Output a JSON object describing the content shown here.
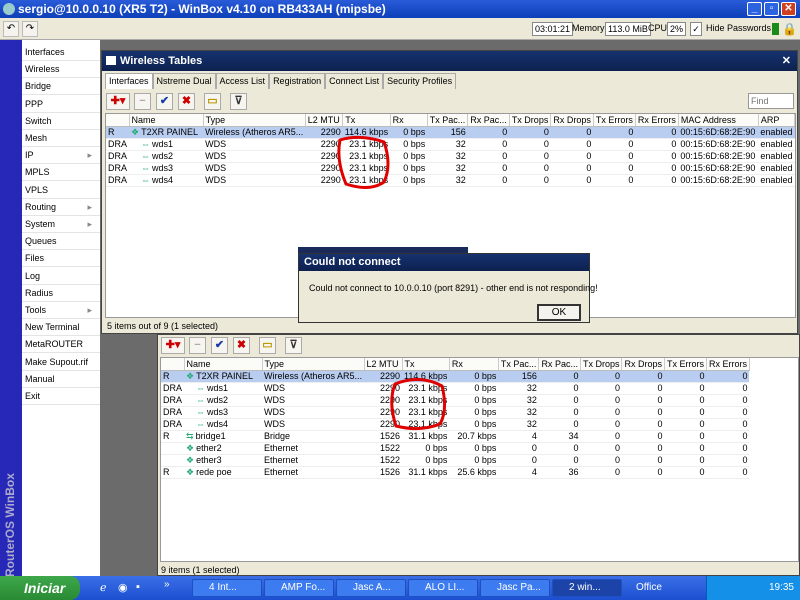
{
  "window": {
    "title": "sergio@10.0.0.10 (XR5 T2) - WinBox v4.10 on RB433AH (mipsbe)"
  },
  "toolbar": {
    "time": "03:01:21",
    "memory_label": "Memory:",
    "memory": "113.0 MiB",
    "cpu_label": "CPU:",
    "cpu": "2%",
    "hide_passwords": "Hide Passwords",
    "hide_passwords_checked": true
  },
  "sidebar": {
    "brand": "RouterOS WinBox",
    "items": [
      {
        "label": "Interfaces"
      },
      {
        "label": "Wireless"
      },
      {
        "label": "Bridge"
      },
      {
        "label": "PPP"
      },
      {
        "label": "Switch"
      },
      {
        "label": "Mesh"
      },
      {
        "label": "IP",
        "sub": true
      },
      {
        "label": "MPLS"
      },
      {
        "label": "VPLS"
      },
      {
        "label": "Routing",
        "sub": true
      },
      {
        "label": "System",
        "sub": true
      },
      {
        "label": "Queues"
      },
      {
        "label": "Files"
      },
      {
        "label": "Log"
      },
      {
        "label": "Radius"
      },
      {
        "label": "Tools",
        "sub": true
      },
      {
        "label": "New Terminal"
      },
      {
        "label": "MetaROUTER"
      },
      {
        "label": "Make Supout.rif"
      },
      {
        "label": "Manual"
      },
      {
        "label": "Exit"
      }
    ]
  },
  "wireless": {
    "title": "Wireless Tables",
    "tabs": [
      "Interfaces",
      "Nstreme Dual",
      "Access List",
      "Registration",
      "Connect List",
      "Security Profiles"
    ],
    "find_placeholder": "Find",
    "columns": [
      "",
      "Name",
      "Type",
      "L2 MTU",
      "Tx",
      "Rx",
      "Tx Pac...",
      "Rx Pac...",
      "Tx Drops",
      "Rx Drops",
      "Tx Errors",
      "Rx Errors",
      "MAC Address",
      "ARP"
    ],
    "rows": [
      [
        "R",
        "T2XR PAINEL",
        "Wireless (Atheros AR5...",
        "2290",
        "114.6 kbps",
        "0 bps",
        "156",
        "0",
        "0",
        "0",
        "0",
        "0",
        "00:15:6D:68:2E:90",
        "enabled"
      ],
      [
        "DRA",
        "wds1",
        "WDS",
        "2290",
        "23.1 kbps",
        "0 bps",
        "32",
        "0",
        "0",
        "0",
        "0",
        "0",
        "00:15:6D:68:2E:90",
        "enabled"
      ],
      [
        "DRA",
        "wds2",
        "WDS",
        "2290",
        "23.1 kbps",
        "0 bps",
        "32",
        "0",
        "0",
        "0",
        "0",
        "0",
        "00:15:6D:68:2E:90",
        "enabled"
      ],
      [
        "DRA",
        "wds3",
        "WDS",
        "2290",
        "23.1 kbps",
        "0 bps",
        "32",
        "0",
        "0",
        "0",
        "0",
        "0",
        "00:15:6D:68:2E:90",
        "enabled"
      ],
      [
        "DRA",
        "wds4",
        "WDS",
        "2290",
        "23.1 kbps",
        "0 bps",
        "32",
        "0",
        "0",
        "0",
        "0",
        "0",
        "00:15:6D:68:2E:90",
        "enabled"
      ]
    ],
    "status": "5 items out of 9 (1 selected)"
  },
  "interfaces": {
    "columns": [
      "",
      "Name",
      "Type",
      "L2 MTU",
      "Tx",
      "Rx",
      "Tx Pac...",
      "Rx Pac...",
      "Tx Drops",
      "Rx Drops",
      "Tx Errors",
      "Rx Errors"
    ],
    "rows": [
      [
        "R",
        "T2XR PAINEL",
        "Wireless (Atheros AR5...",
        "2290",
        "114.6 kbps",
        "0 bps",
        "156",
        "0",
        "0",
        "0",
        "0",
        "0"
      ],
      [
        "DRA",
        "wds1",
        "WDS",
        "2290",
        "23.1 kbps",
        "0 bps",
        "32",
        "0",
        "0",
        "0",
        "0",
        "0"
      ],
      [
        "DRA",
        "wds2",
        "WDS",
        "2290",
        "23.1 kbps",
        "0 bps",
        "32",
        "0",
        "0",
        "0",
        "0",
        "0"
      ],
      [
        "DRA",
        "wds3",
        "WDS",
        "2290",
        "23.1 kbps",
        "0 bps",
        "32",
        "0",
        "0",
        "0",
        "0",
        "0"
      ],
      [
        "DRA",
        "wds4",
        "WDS",
        "2290",
        "23.1 kbps",
        "0 bps",
        "32",
        "0",
        "0",
        "0",
        "0",
        "0"
      ],
      [
        "R",
        "bridge1",
        "Bridge",
        "1526",
        "31.1 kbps",
        "20.7 kbps",
        "4",
        "34",
        "0",
        "0",
        "0",
        "0"
      ],
      [
        "",
        "ether2",
        "Ethernet",
        "1522",
        "0 bps",
        "0 bps",
        "0",
        "0",
        "0",
        "0",
        "0",
        "0"
      ],
      [
        "",
        "ether3",
        "Ethernet",
        "1522",
        "0 bps",
        "0 bps",
        "0",
        "0",
        "0",
        "0",
        "0",
        "0"
      ],
      [
        "R",
        "rede poe",
        "Ethernet",
        "1526",
        "31.1 kbps",
        "25.6 kbps",
        "4",
        "36",
        "0",
        "0",
        "0",
        "0"
      ]
    ],
    "status": "9 items (1 selected)"
  },
  "dialog": {
    "title": "Could not connect",
    "message": "Could not connect to 10.0.0.10 (port 8291) - other end is not responding!",
    "ok": "OK"
  },
  "taskbar": {
    "start": "Iniciar",
    "tasks": [
      "4 Int...",
      "AMP Fo...",
      "Jasc A...",
      "ALO LI...",
      "Jasc Pa...",
      "2 win..."
    ],
    "office": "Office",
    "clock": "19:35"
  },
  "colors": {
    "annotation": "#e00000",
    "selection": "#b9cdf0",
    "title": "#0d2150"
  }
}
